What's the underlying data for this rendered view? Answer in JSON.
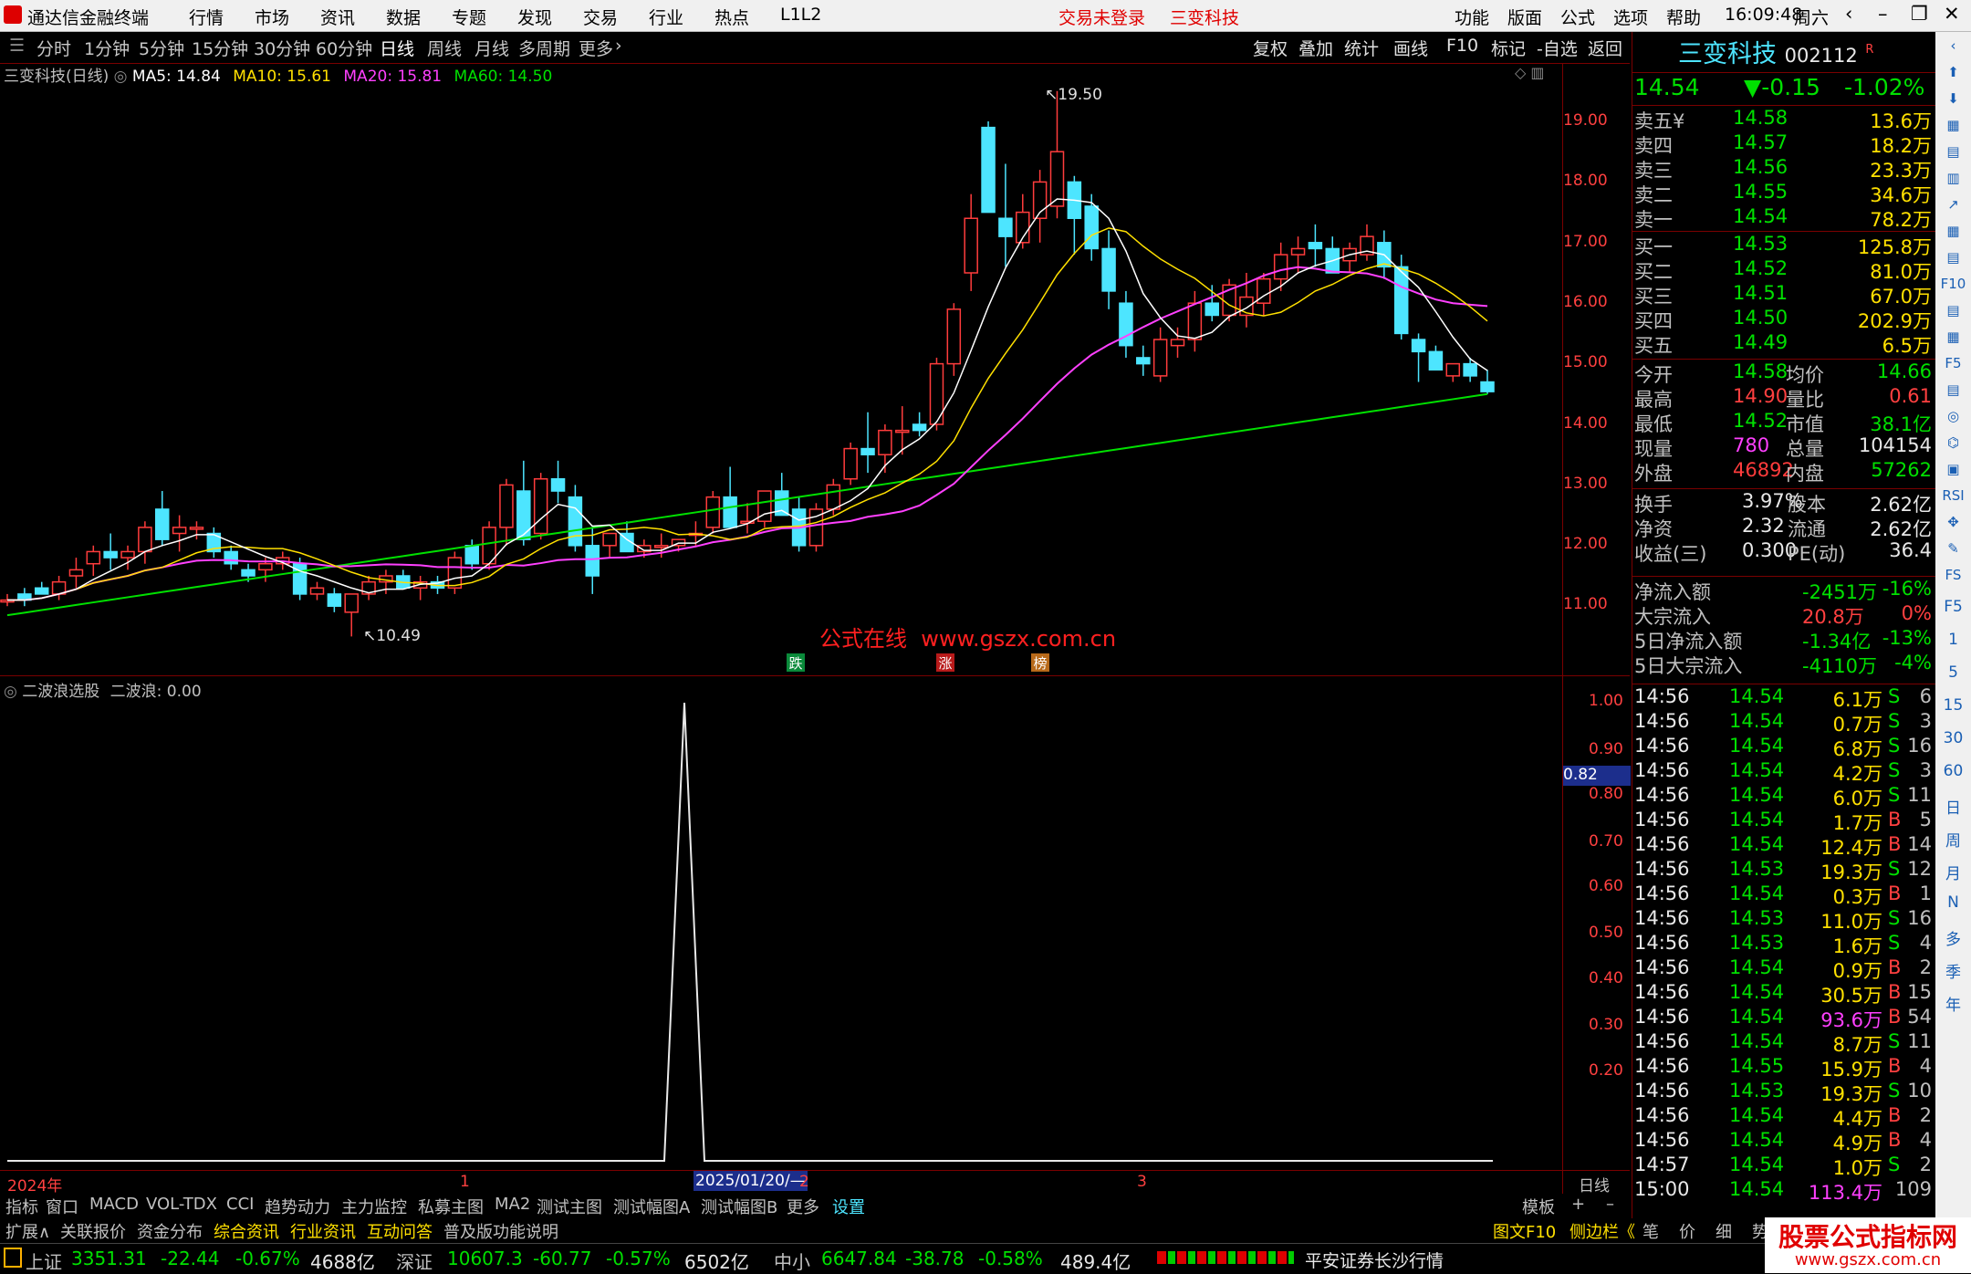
{
  "window": {
    "app_title": "通达信金融终端",
    "menus": [
      "行情",
      "市场",
      "资讯",
      "数据",
      "专题",
      "发现",
      "交易",
      "行业",
      "热点",
      "L1L2"
    ],
    "login_status": "交易未登录",
    "stock_title": "三变科技",
    "right_menus": [
      "功能",
      "版面",
      "公式",
      "选项",
      "帮助"
    ],
    "clock": "16:09:48",
    "weekday": "周六"
  },
  "timeframes": [
    "分时",
    "1分钟",
    "5分钟",
    "15分钟",
    "30分钟",
    "60分钟",
    "日线",
    "周线",
    "月线",
    "多周期",
    "更多"
  ],
  "active_timeframe": "日线",
  "tools": [
    "复权",
    "叠加",
    "统计",
    "画线",
    "F10",
    "标记",
    "-自选",
    "返回"
  ],
  "chart_header": {
    "name": "三变科技(日线)",
    "ma5": "MA5: 14.84",
    "ma10": "MA10: 15.61",
    "ma20": "MA20: 15.81",
    "ma60": "MA60: 14.50"
  },
  "price_axis": [
    "19.00",
    "18.00",
    "17.00",
    "16.00",
    "15.00",
    "14.00",
    "13.00",
    "12.00",
    "11.00"
  ],
  "indicator_axis": [
    "1.00",
    "0.90",
    "0.80",
    "0.70",
    "0.60",
    "0.50",
    "0.40",
    "0.30",
    "0.20"
  ],
  "indicator_current": "0.82",
  "annotations": {
    "high": "19.50",
    "low": "10.49",
    "watermark": "公式在线  www.gszx.com.cn",
    "marks": [
      "跌",
      "涨",
      "榜"
    ]
  },
  "indicator_header": {
    "name": "二波浪选股",
    "value": "二波浪: 0.00"
  },
  "x_axis": {
    "year": "2024年",
    "m1": "1",
    "date": "2025/01/20/—",
    "m2": "2",
    "m3": "3",
    "period": "日线"
  },
  "bottom_tabs": [
    "指标",
    "窗口",
    "MACD",
    "VOL-TDX",
    "CCI",
    "趋势动力",
    "主力监控",
    "私募主图",
    "MA2",
    "测试主图",
    "测试幅图A",
    "测试幅图B",
    "更多",
    "设置"
  ],
  "template_label": "模板",
  "bottom_tabs2": [
    "扩展∧",
    "关联报价",
    "资金分布",
    "综合资讯",
    "行业资讯",
    "互动问答",
    "普及版功能说明"
  ],
  "side_tabs": [
    "图文F10",
    "侧边栏《",
    "笔",
    "价",
    "细",
    "势"
  ],
  "quote": {
    "name": "三变科技",
    "code": "002112",
    "flag": "R",
    "price": "14.54",
    "change": "▼-0.15",
    "pct": "-1.02%",
    "asks": [
      {
        "label": "卖五¥",
        "price": "14.58",
        "vol": "13.6万"
      },
      {
        "label": "卖四",
        "price": "14.57",
        "vol": "18.2万"
      },
      {
        "label": "卖三",
        "price": "14.56",
        "vol": "23.3万"
      },
      {
        "label": "卖二",
        "price": "14.55",
        "vol": "34.6万"
      },
      {
        "label": "卖一",
        "price": "14.54",
        "vol": "78.2万"
      }
    ],
    "bids": [
      {
        "label": "买一",
        "price": "14.53",
        "vol": "125.8万"
      },
      {
        "label": "买二",
        "price": "14.52",
        "vol": "81.0万"
      },
      {
        "label": "买三",
        "price": "14.51",
        "vol": "67.0万"
      },
      {
        "label": "买四",
        "price": "14.50",
        "vol": "202.9万"
      },
      {
        "label": "买五",
        "price": "14.49",
        "vol": "6.5万"
      }
    ],
    "stats": [
      {
        "l1": "今开",
        "v1": "14.58",
        "l2": "均价",
        "v2": "14.66"
      },
      {
        "l1": "最高",
        "v1": "14.90",
        "l2": "量比",
        "v2": "0.61"
      },
      {
        "l1": "最低",
        "v1": "14.52",
        "l2": "市值",
        "v2": "38.1亿"
      },
      {
        "l1": "现量",
        "v1": "780",
        "l2": "总量",
        "v2": "104154"
      },
      {
        "l1": "外盘",
        "v1": "46892",
        "l2": "内盘",
        "v2": "57262"
      }
    ],
    "stats2": [
      {
        "l1": "换手",
        "v1": "3.97%",
        "l2": "股本",
        "v2": "2.62亿"
      },
      {
        "l1": "净资",
        "v1": "2.32",
        "l2": "流通",
        "v2": "2.62亿"
      },
      {
        "l1": "收益(三)",
        "v1": "0.300",
        "l2": "PE(动)",
        "v2": "36.4"
      }
    ],
    "flows": [
      {
        "label": "净流入额",
        "value": "-2451万",
        "pct": "-16%"
      },
      {
        "label": "大宗流入",
        "value": "20.8万",
        "pct": "0%"
      },
      {
        "label": "5日净流入额",
        "value": "-1.34亿",
        "pct": "-13%"
      },
      {
        "label": "5日大宗流入",
        "value": "-4110万",
        "pct": "-4%"
      }
    ],
    "ticks": [
      {
        "t": "14:56",
        "p": "14.54",
        "v": "6.1万",
        "s": "S",
        "n": "6"
      },
      {
        "t": "14:56",
        "p": "14.54",
        "v": "0.7万",
        "s": "S",
        "n": "3"
      },
      {
        "t": "14:56",
        "p": "14.54",
        "v": "6.8万",
        "s": "S",
        "n": "16"
      },
      {
        "t": "14:56",
        "p": "14.54",
        "v": "4.2万",
        "s": "S",
        "n": "3"
      },
      {
        "t": "14:56",
        "p": "14.54",
        "v": "6.0万",
        "s": "S",
        "n": "11"
      },
      {
        "t": "14:56",
        "p": "14.54",
        "v": "1.7万",
        "s": "B",
        "n": "5"
      },
      {
        "t": "14:56",
        "p": "14.54",
        "v": "12.4万",
        "s": "B",
        "n": "14"
      },
      {
        "t": "14:56",
        "p": "14.53",
        "v": "19.3万",
        "s": "S",
        "n": "12"
      },
      {
        "t": "14:56",
        "p": "14.54",
        "v": "0.3万",
        "s": "B",
        "n": "1"
      },
      {
        "t": "14:56",
        "p": "14.53",
        "v": "11.0万",
        "s": "S",
        "n": "16"
      },
      {
        "t": "14:56",
        "p": "14.53",
        "v": "1.6万",
        "s": "S",
        "n": "4"
      },
      {
        "t": "14:56",
        "p": "14.54",
        "v": "0.9万",
        "s": "B",
        "n": "2"
      },
      {
        "t": "14:56",
        "p": "14.54",
        "v": "30.5万",
        "s": "B",
        "n": "15"
      },
      {
        "t": "14:56",
        "p": "14.54",
        "v": "93.6万",
        "s": "B",
        "n": "54"
      },
      {
        "t": "14:56",
        "p": "14.54",
        "v": "8.7万",
        "s": "S",
        "n": "11"
      },
      {
        "t": "14:56",
        "p": "14.55",
        "v": "15.9万",
        "s": "B",
        "n": "4"
      },
      {
        "t": "14:56",
        "p": "14.53",
        "v": "19.3万",
        "s": "S",
        "n": "10"
      },
      {
        "t": "14:56",
        "p": "14.54",
        "v": "4.4万",
        "s": "B",
        "n": "2"
      },
      {
        "t": "14:56",
        "p": "14.54",
        "v": "4.9万",
        "s": "B",
        "n": "4"
      },
      {
        "t": "14:57",
        "p": "14.54",
        "v": "1.0万",
        "s": "S",
        "n": "2"
      },
      {
        "t": "15:00",
        "p": "14.54",
        "v": "113.4万",
        "s": "",
        "n": "109"
      }
    ]
  },
  "status": {
    "sh_label": "上证",
    "sh": "3351.31",
    "sh_chg": "-22.44",
    "sh_pct": "-0.67%",
    "sh_amt": "4688亿",
    "sz_label": "深证",
    "sz": "10607.3",
    "sz_chg": "-60.77",
    "sz_pct": "-0.57%",
    "sz_amt": "6502亿",
    "zx_label": "中小",
    "zx": "6647.84",
    "zx_chg": "-38.78",
    "zx_pct": "-0.58%",
    "zx_amt": "489.4亿",
    "broker": "平安证券长沙行情"
  },
  "watermark_brand": "股票公式指标网",
  "watermark_url": "www.gszx.com.cn",
  "side_icon_labels": [
    "F5",
    "1",
    "5",
    "15",
    "30",
    "60",
    "日",
    "周",
    "月",
    "N",
    "多",
    "季",
    "年"
  ],
  "colors": {
    "up": "#ff3c3c",
    "down": "#4de5ff",
    "ma5": "#ffffff",
    "ma10": "#ffe000",
    "ma20": "#ff40ff",
    "ma60": "#00e000",
    "border": "#7a0000"
  }
}
